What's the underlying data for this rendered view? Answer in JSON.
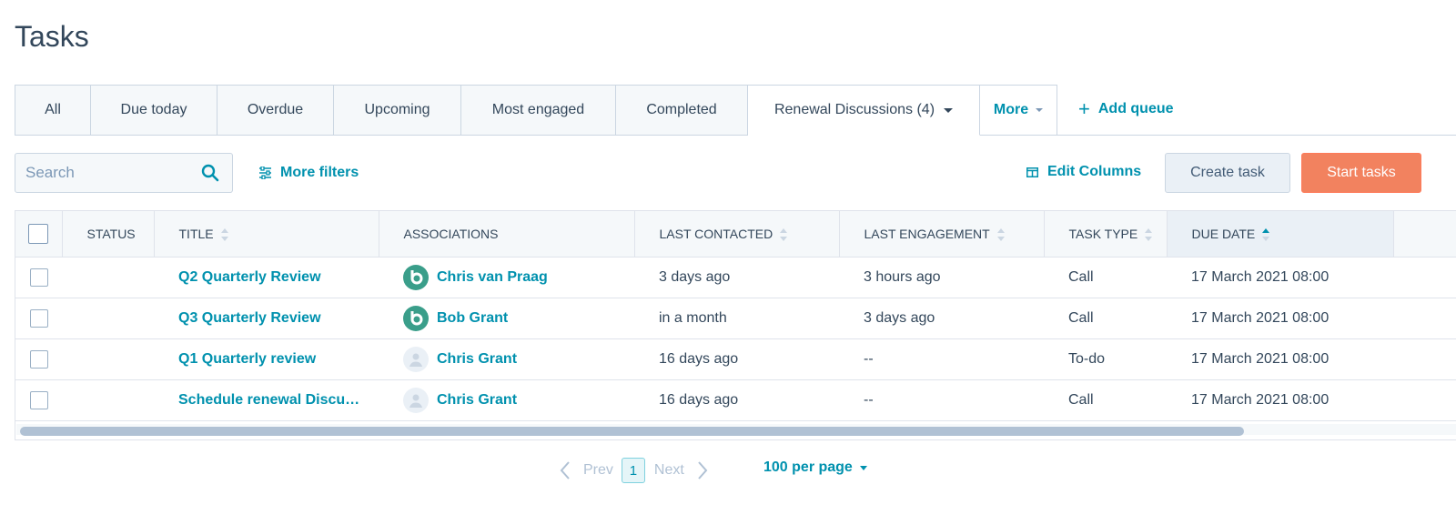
{
  "page": {
    "title": "Tasks"
  },
  "tabs": [
    {
      "label": "All"
    },
    {
      "label": "Due today"
    },
    {
      "label": "Overdue"
    },
    {
      "label": "Upcoming"
    },
    {
      "label": "Most engaged"
    },
    {
      "label": "Completed"
    },
    {
      "label": "Renewal Discussions (4)"
    },
    {
      "label": "More"
    }
  ],
  "add_queue": {
    "label": "Add queue",
    "icon": "plus-icon"
  },
  "toolbar": {
    "search_placeholder": "Search",
    "more_filters": "More filters",
    "edit_columns": "Edit Columns",
    "create_task": "Create task",
    "start_tasks": "Start tasks"
  },
  "table": {
    "headers": {
      "status": "STATUS",
      "title": "TITLE",
      "associations": "ASSOCIATIONS",
      "last_contacted": "LAST CONTACTED",
      "last_engagement": "LAST ENGAGEMENT",
      "task_type": "TASK TYPE",
      "due_date": "DUE DATE"
    },
    "rows": [
      {
        "title": "Q2 Quarterly Review",
        "association": "Chris van Praag",
        "avatar": "company-logo-icon",
        "last_contacted": "3 days ago",
        "last_engagement": "3 hours ago",
        "task_type": "Call",
        "due_date": "17 March 2021 08:00"
      },
      {
        "title": "Q3 Quarterly Review",
        "association": "Bob Grant",
        "avatar": "company-logo-icon",
        "last_contacted": "in a month",
        "last_engagement": "3 days ago",
        "task_type": "Call",
        "due_date": "17 March 2021 08:00"
      },
      {
        "title": "Q1 Quarterly review",
        "association": "Chris Grant",
        "avatar": "person-avatar-icon",
        "last_contacted": "16 days ago",
        "last_engagement": "--",
        "task_type": "To-do",
        "due_date": "17 March 2021 08:00"
      },
      {
        "title": "Schedule renewal Discu…",
        "association": "Chris Grant",
        "avatar": "person-avatar-icon",
        "last_contacted": "16 days ago",
        "last_engagement": "--",
        "task_type": "Call",
        "due_date": "17 March 2021 08:00"
      }
    ]
  },
  "pagination": {
    "prev": "Prev",
    "current": "1",
    "next": "Next",
    "per_page": "100 per page"
  },
  "colors": {
    "accent": "#0091ae",
    "primary_button": "#f2825f",
    "border": "#cbd6e2",
    "text": "#33475b"
  }
}
